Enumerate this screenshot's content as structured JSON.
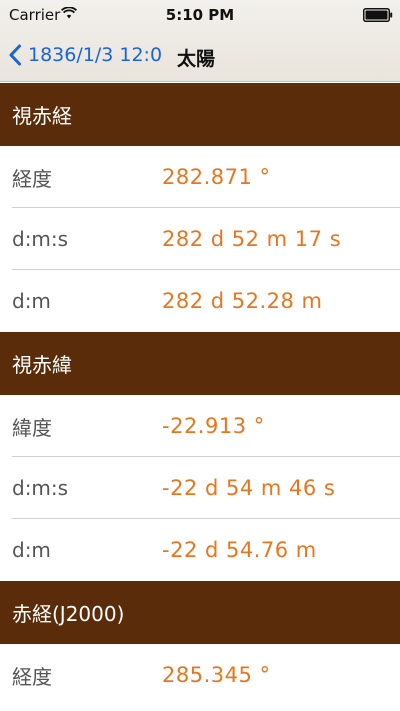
{
  "status_bar": {
    "carrier": "Carrier",
    "time": "5:10 PM"
  },
  "nav": {
    "back_label": "1836/1/3 12:0",
    "title": "太陽"
  },
  "colors": {
    "header_bg": "#5a2c0a",
    "value_text": "#e8761e",
    "link_blue": "#1a64d6"
  },
  "sections": [
    {
      "title": "視赤経",
      "rows": [
        {
          "label": "経度",
          "value": "282.871 °"
        },
        {
          "label": "d:m:s",
          "value": "282 d 52 m 17 s"
        },
        {
          "label": "d:m",
          "value": "282 d 52.28 m"
        }
      ]
    },
    {
      "title": "視赤緯",
      "rows": [
        {
          "label": "緯度",
          "value": "-22.913 °"
        },
        {
          "label": "d:m:s",
          "value": "-22 d 54 m 46 s"
        },
        {
          "label": "d:m",
          "value": "-22 d 54.76 m"
        }
      ]
    },
    {
      "title": "赤経(J2000)",
      "rows": [
        {
          "label": "経度",
          "value": "285.345 °"
        }
      ]
    }
  ]
}
